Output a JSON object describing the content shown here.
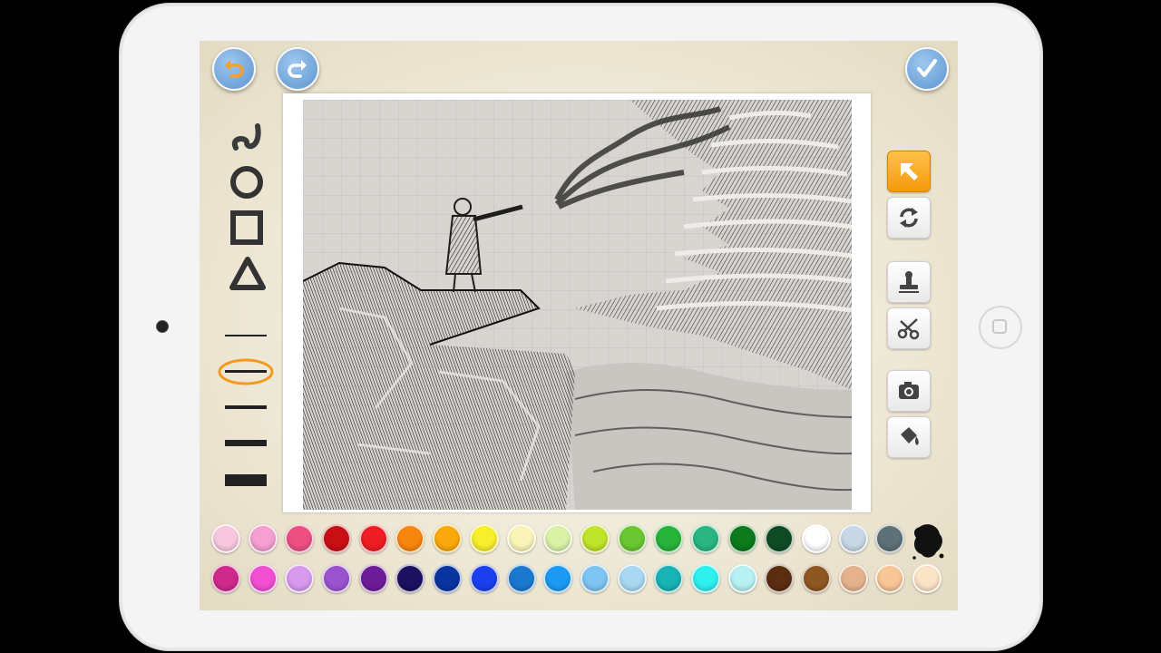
{
  "header": {
    "undo_icon": "undo-arrow-icon",
    "redo_icon": "redo-arrow-icon",
    "done_icon": "checkmark-icon"
  },
  "shape_tools": [
    "freehand-squiggle",
    "circle",
    "square",
    "triangle"
  ],
  "line_widths": {
    "options": [
      1,
      2,
      3,
      4,
      5
    ],
    "selected": 2,
    "selected_color": "#f39a1e"
  },
  "right_tools": [
    {
      "name": "select-arrow",
      "active": true
    },
    {
      "name": "rotate"
    },
    {
      "name": "stamp"
    },
    {
      "name": "scissors"
    },
    {
      "name": "camera"
    },
    {
      "name": "paint-bucket"
    }
  ],
  "palette": {
    "row1": [
      "#f9c8df",
      "#f59fd2",
      "#ee4f83",
      "#c80f14",
      "#ee1e25",
      "#f7860f",
      "#f9a90c",
      "#f7ee2c",
      "#fbf4b8",
      "#d9f2a7",
      "#bfe42a",
      "#6ac732",
      "#27b43a",
      "#29b681",
      "#0d7a1c",
      "#0f4c25",
      "#ffffff",
      "#c8d8e6",
      "#5e7078"
    ],
    "row2": [
      "#cf2a8b",
      "#f24fd2",
      "#d89aef",
      "#9b52cf",
      "#6d1c98",
      "#1c1060",
      "#08359f",
      "#1b3fee",
      "#1a79cf",
      "#1c9af2",
      "#7dc4f2",
      "#a8d8f2",
      "#18b3b5",
      "#2ef0ef",
      "#b7f1f3",
      "#5b2e11",
      "#8e5722",
      "#e6b28e",
      "#f8c596",
      "#fbe3c6"
    ],
    "ink_color": "#111111"
  },
  "canvas": {
    "grid": true,
    "background": "#d8d5d1"
  }
}
